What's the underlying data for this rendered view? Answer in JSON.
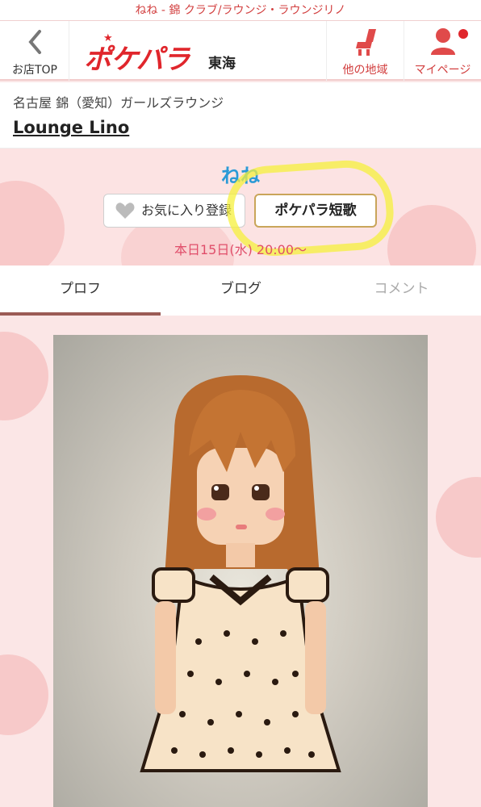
{
  "page_title": "ねね - 錦 クラブ/ラウンジ・ラウンジリノ",
  "header": {
    "back_label": "お店TOP",
    "logo_text": "ポケパラ",
    "region": "東海",
    "other_region_label": "他の地域",
    "mypage_label": "マイページ"
  },
  "shop": {
    "category": "名古屋 錦（愛知）ガールズラウンジ",
    "name": "Lounge Lino"
  },
  "cast": {
    "name": "ねね",
    "favorite_label": "お気に入り登録",
    "tanka_label": "ポケパラ短歌",
    "schedule": "本日15日(水) 20:00～"
  },
  "tabs": [
    {
      "label": "プロフ",
      "active": true
    },
    {
      "label": "ブログ",
      "active": false
    },
    {
      "label": "コメント",
      "active": false,
      "disabled": true
    }
  ],
  "colors": {
    "brand_red": "#e0262c",
    "cast_name_blue": "#2a9ad6",
    "schedule_pink": "#e04e6a",
    "tab_active": "#9b5b55",
    "highlight_yellow": "#f6f03c"
  }
}
